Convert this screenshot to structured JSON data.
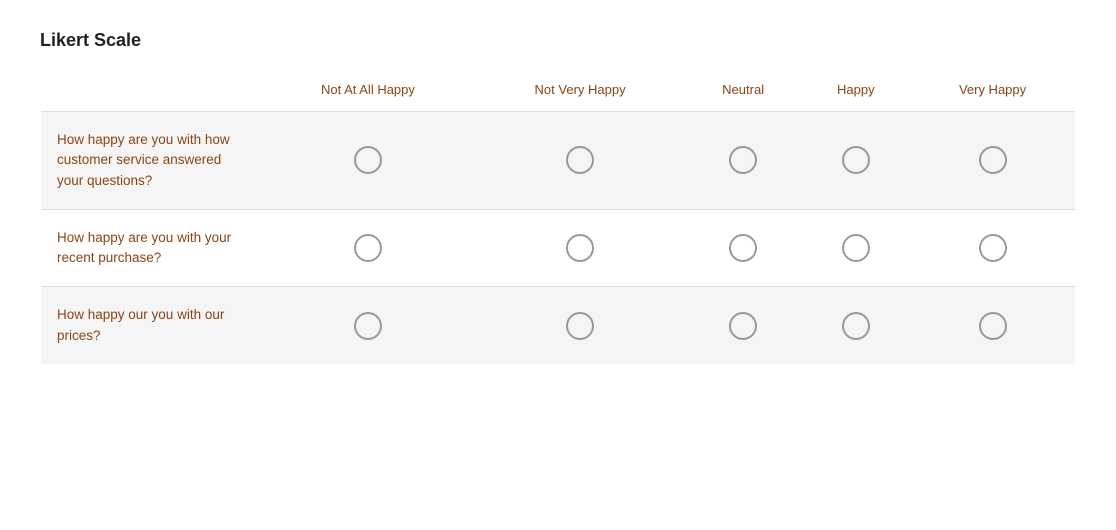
{
  "title": "Likert Scale",
  "columns": {
    "question": "",
    "col1": "Not At All Happy",
    "col2": "Not Very Happy",
    "col3": "Neutral",
    "col4": "Happy",
    "col5": "Very Happy"
  },
  "rows": [
    {
      "question": "How happy are you with how customer service answered your questions?",
      "name": "q1"
    },
    {
      "question": "How happy are you with your recent purchase?",
      "name": "q2"
    },
    {
      "question": "How happy our you with our prices?",
      "name": "q3"
    }
  ]
}
